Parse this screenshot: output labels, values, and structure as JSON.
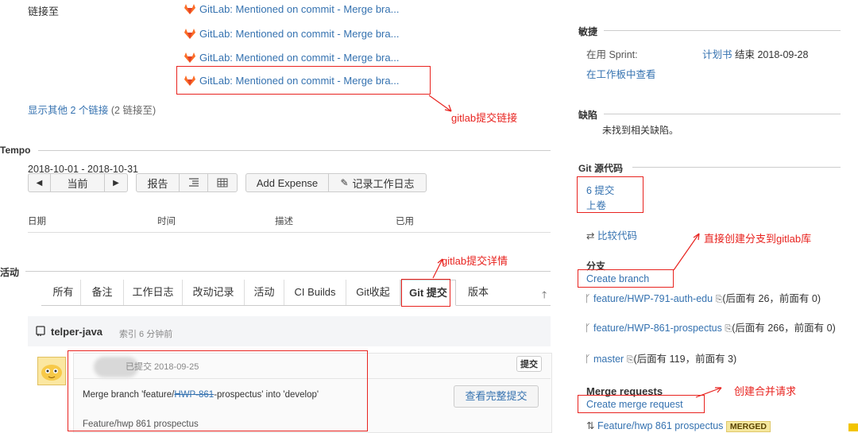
{
  "links": {
    "label": "链接至",
    "items": [
      "GitLab: Mentioned on commit - Merge bra...",
      "GitLab: Mentioned on commit - Merge bra...",
      "GitLab: Mentioned on commit - Merge bra...",
      "GitLab: Mentioned on commit - Merge bra..."
    ],
    "show_more": "显示其他 2 个链接",
    "show_more_suffix": "(2 链接至)"
  },
  "tempo": {
    "title": "Tempo",
    "date_range": "2018-10-01 - 2018-10-31",
    "current_label": "当前",
    "report_label": "报告",
    "add_expense": "Add Expense",
    "log_work": "记录工作日志",
    "columns": [
      "日期",
      "时间",
      "描述",
      "已用"
    ]
  },
  "activity": {
    "title": "活动",
    "tabs": [
      "所有",
      "备注",
      "工作日志",
      "改动记录",
      "活动",
      "CI Builds",
      "Git收起",
      "Git 提交",
      "版本"
    ],
    "active_tab": "Git 提交",
    "repo_name": "telper-java",
    "repo_meta": "索引 6 分钟前",
    "commit_meta": "已提交 2018-09-25",
    "commit_badge": "提交",
    "commit_message": "Merge branch 'feature/HWP-861-prospectus' into 'develop'",
    "commit_msg_prefix": "Merge branch 'feature/",
    "commit_msg_strike": "HWP-861",
    "commit_msg_suffix": "-prospectus' into 'develop'",
    "view_full_commit": "查看完整提交",
    "commit_title": "Feature/hwp 861 prospectus"
  },
  "agile": {
    "title": "敏捷",
    "sprint_label": "在用 Sprint:",
    "sprint_value": "计划书",
    "sprint_end": "结束 2018-09-28",
    "board_link": "在工作板中查看"
  },
  "bugs": {
    "title": "缺陷",
    "empty": "未找到相关缺陷。"
  },
  "git": {
    "title": "Git 源代码",
    "commits": "6 提交",
    "pushes": "上卷",
    "compare": "比较代码",
    "branches_title": "分支",
    "create_branch": "Create branch",
    "branches": [
      {
        "name": "feature/HWP-791-auth-edu",
        "info": "(后面有 26，前面有 0)"
      },
      {
        "name": "feature/HWP-861-prospectus",
        "info": "(后面有 266，前面有 0)"
      },
      {
        "name": "master",
        "info": "(后面有 119，前面有 3)"
      }
    ],
    "mr_title": "Merge requests",
    "create_mr": "Create merge request",
    "mr_item": "Feature/hwp 861 prospectus",
    "mr_status": "MERGED"
  },
  "annotations": {
    "gitlab_link": "gitlab提交链接",
    "gitlab_detail": "gitlab提交详情",
    "create_branch_note": "直接创建分支到gitlab库",
    "create_mr_note": "创建合并请求"
  },
  "colors": {
    "link": "#3572b0",
    "annotation": "#e8231f",
    "gitlab": "#fc6d26",
    "merged_badge": "#f5e79e"
  }
}
